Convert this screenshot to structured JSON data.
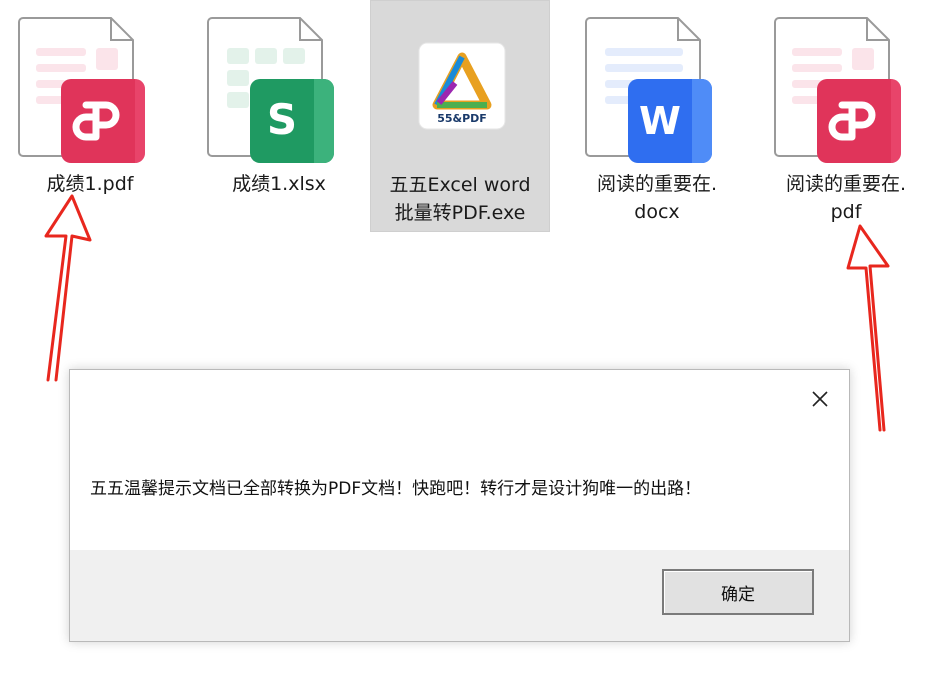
{
  "files": [
    {
      "name_line1": "成绩1.pdf",
      "name_line2": "",
      "type": "pdf",
      "icon": "pdf-file-icon",
      "badge_color": "#e0345a"
    },
    {
      "name_line1": "成绩1.xlsx",
      "name_line2": "",
      "type": "xlsx",
      "icon": "spreadsheet-file-icon",
      "badge_letter": "S",
      "badge_color": "#1f9a62"
    },
    {
      "name_line1": "五五Excel word",
      "name_line2": "批量转PDF.exe",
      "type": "exe",
      "icon": "app-exe-icon",
      "logo_text": "55&PDF",
      "selected": true
    },
    {
      "name_line1": "阅读的重要在.",
      "name_line2": "docx",
      "type": "docx",
      "icon": "word-file-icon",
      "badge_letter": "W",
      "badge_color": "#2f6ef0"
    },
    {
      "name_line1": "阅读的重要在.",
      "name_line2": "pdf",
      "type": "pdf",
      "icon": "pdf-file-icon",
      "badge_color": "#e0345a"
    }
  ],
  "dialog": {
    "message": "五五温馨提示文档已全部转换为PDF文档！快跑吧！转行才是设计狗唯一的出路！",
    "ok_label": "确定",
    "close_icon": "close-icon"
  },
  "annotations": {
    "arrow_color": "#e8271e"
  }
}
